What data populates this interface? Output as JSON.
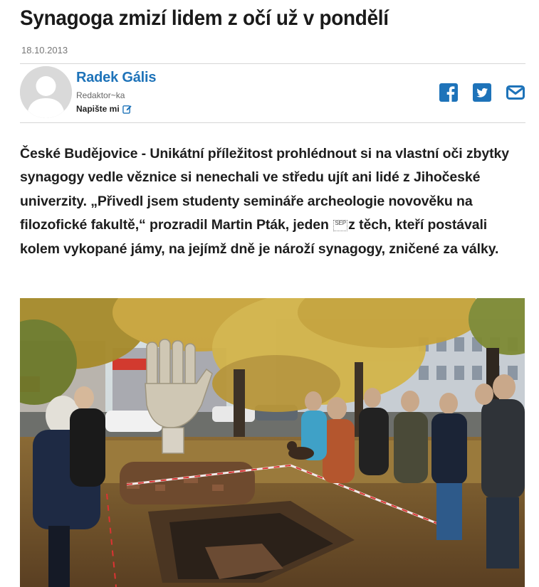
{
  "article": {
    "title": "Synagoga zmizí lidem z očí už v pondělí",
    "date": "18.10.2013",
    "perex_before": "České Budějovice - Unikátní příležitost prohlédnout si na vlastní oči zbytky synagogy vedle věznice si nenechali ve středu ujít ani lidé z Jihočeské univerzity. „Přivedl jsem studenty semináře archeologie novověku na filozofické fakultě,“ prozradil Martin Pták, jeden",
    "perex_glyph": "SEP",
    "perex_after": "z těch, kteří postávali kolem vykopané jámy, na jejímž dně je nároží synagogy, zničené za války."
  },
  "author": {
    "name": "Radek Gális",
    "role": "Redaktor~ka",
    "write_label": "Napište mi"
  },
  "share": {
    "icons": [
      "facebook-icon",
      "twitter-icon",
      "mail-icon"
    ],
    "colors": {
      "brand": "#1e73b9",
      "icon": "#1e73b9"
    }
  },
  "photo": {
    "subject": "lidé u vykopané jámy se zbytky synagogy"
  }
}
